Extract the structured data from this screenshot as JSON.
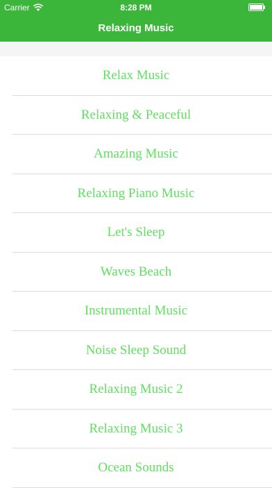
{
  "status_bar": {
    "carrier": "Carrier",
    "time": "8:28 PM",
    "wifi_icon": "wifi-icon",
    "battery_icon": "battery-icon"
  },
  "nav": {
    "title": "Relaxing Music"
  },
  "colors": {
    "nav_bar": "#3bb63b",
    "item_text": "#5fe05f",
    "separator": "#dcdcdc",
    "spacer": "#f5f5f5"
  },
  "items": [
    {
      "label": "Relax Music"
    },
    {
      "label": "Relaxing & Peaceful"
    },
    {
      "label": "Amazing Music"
    },
    {
      "label": "Relaxing Piano Music"
    },
    {
      "label": "Let's Sleep"
    },
    {
      "label": "Waves Beach"
    },
    {
      "label": "Instrumental Music"
    },
    {
      "label": "Noise Sleep Sound"
    },
    {
      "label": "Relaxing Music 2"
    },
    {
      "label": "Relaxing Music 3"
    },
    {
      "label": "Ocean Sounds"
    }
  ]
}
